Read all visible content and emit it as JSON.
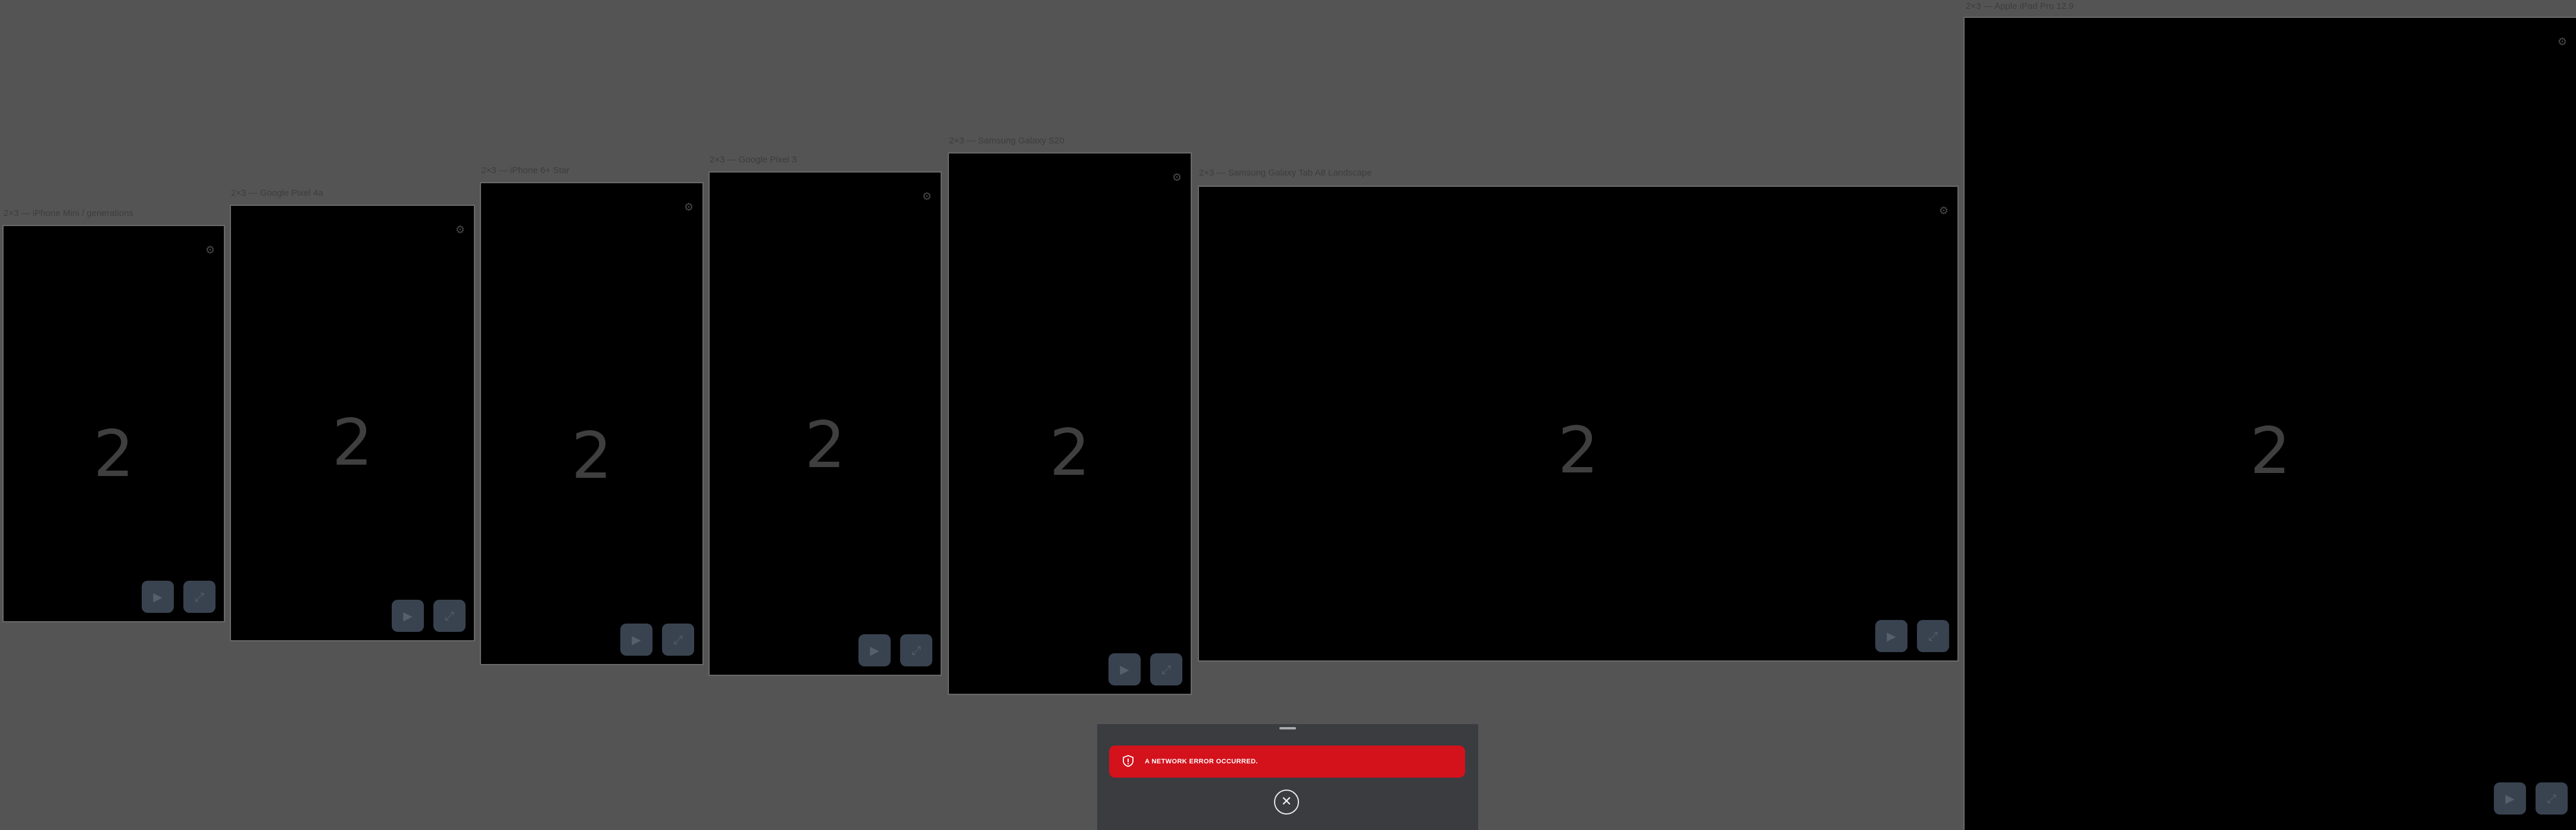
{
  "frames": [
    {
      "label": "2×3 — iPhone Mini / generations",
      "number": "2",
      "settings_icon": "settings-icon",
      "play_icon": "play-icon",
      "fullscreen_icon": "fullscreen-icon"
    },
    {
      "label": "2×3 — Google Pixel 4a",
      "number": "2",
      "settings_icon": "settings-icon",
      "play_icon": "play-icon",
      "fullscreen_icon": "fullscreen-icon"
    },
    {
      "label": "2×3 — iPhone 6+ Star",
      "number": "2",
      "settings_icon": "settings-icon",
      "play_icon": "play-icon",
      "fullscreen_icon": "fullscreen-icon"
    },
    {
      "label": "2×3 — Google Pixel 3",
      "number": "2",
      "settings_icon": "settings-icon",
      "play_icon": "play-icon",
      "fullscreen_icon": "fullscreen-icon"
    },
    {
      "label": "2×3 — Samsung Galaxy S20",
      "number": "2",
      "settings_icon": "settings-icon",
      "play_icon": "play-icon",
      "fullscreen_icon": "fullscreen-icon"
    },
    {
      "label": "2×3 — Samsung Galaxy Tab A8 Landscape",
      "number": "2",
      "settings_icon": "settings-icon",
      "play_icon": "play-icon",
      "fullscreen_icon": "fullscreen-icon"
    },
    {
      "label": "2×3 — Apple iPad Pro 12.9",
      "number": "2",
      "settings_icon": "settings-icon",
      "play_icon": "play-icon",
      "fullscreen_icon": "fullscreen-icon"
    }
  ],
  "error_sheet": {
    "message": "A NETWORK ERROR OCCURRED.",
    "icon": "alert-shield-icon",
    "close_icon": "close-icon",
    "toast_color": "#d3121c",
    "sheet_color": "#3a3c40"
  }
}
